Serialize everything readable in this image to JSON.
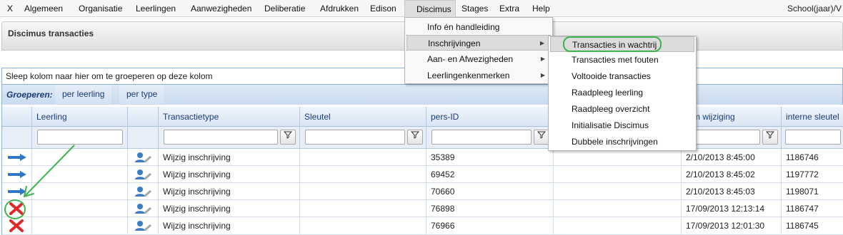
{
  "menubar": {
    "items": [
      "X",
      "Algemeen",
      "Organisatie",
      "Leerlingen",
      "Aanwezigheden",
      "Deliberatie",
      "Afdrukken",
      "Edison",
      "Discimus",
      "Stages",
      "Extra",
      "Help"
    ],
    "right_text": "School(jaar)/V"
  },
  "panel": {
    "title": "Discimus transacties"
  },
  "grouping": {
    "drag_hint": "Sleep kolom naar hier om te groeperen op deze kolom",
    "label": "Groeperen:",
    "options": [
      "per leerling",
      "per type"
    ]
  },
  "grid": {
    "columns": [
      "Leerling",
      "Transactietype",
      "Sleutel",
      "pers-ID",
      "Datum wijziging",
      "interne sleutel"
    ],
    "datum_column_visible": "tum wijziging",
    "filter_icon": "funnel-icon",
    "rows": [
      {
        "status": "arrow",
        "type": "Wijzig inschrijving",
        "pers_id": "35389",
        "datum": "2/10/2013 8:45:00",
        "interne": "1186746"
      },
      {
        "status": "arrow",
        "type": "Wijzig inschrijving",
        "pers_id": "69452",
        "datum": "2/10/2013 8:45:02",
        "interne": "1197772"
      },
      {
        "status": "arrow",
        "type": "Wijzig inschrijving",
        "pers_id": "70660",
        "datum": "2/10/2013 8:45:03",
        "interne": "1198071"
      },
      {
        "status": "error",
        "type": "Wijzig inschrijving",
        "pers_id": "76898",
        "datum": "17/09/2013 12:13:14",
        "interne": "1186747"
      },
      {
        "status": "error",
        "type": "Wijzig inschrijving",
        "pers_id": "76966",
        "datum": "17/09/2013 12:01:30",
        "interne": "1186745"
      }
    ]
  },
  "discimus_menu": {
    "items": [
      "Info én handleiding",
      "Inschrijvingen",
      "Aan- en Afwezigheden",
      "Leerlingenkenmerken"
    ],
    "submenu_arrow": "▶"
  },
  "inschrijvingen_submenu": {
    "items": [
      "Transacties in wachtrij",
      "Transacties met fouten",
      "Voltooide transacties",
      "Raadpleeg leerling",
      "Raadpleeg overzicht",
      "Initialisatie Discimus",
      "Dubbele inschrijvingen"
    ]
  },
  "colors": {
    "annotation": "#3cb44b",
    "header_text": "#1b3a78",
    "arrow": "#2f78c8",
    "error": "#e02828"
  }
}
